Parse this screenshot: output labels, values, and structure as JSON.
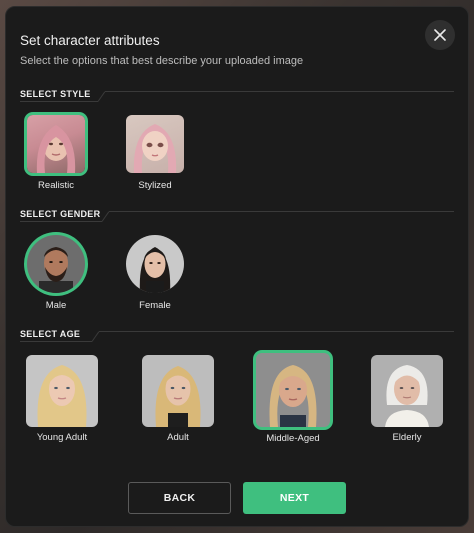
{
  "dialog": {
    "title": "Set character attributes",
    "subtitle": "Select the options that best describe your uploaded image"
  },
  "sections": {
    "style": {
      "label": "SELECT STYLE",
      "options": [
        {
          "label": "Realistic",
          "selected": true
        },
        {
          "label": "Stylized",
          "selected": false
        }
      ]
    },
    "gender": {
      "label": "SELECT GENDER",
      "options": [
        {
          "label": "Male",
          "selected": true
        },
        {
          "label": "Female",
          "selected": false
        }
      ]
    },
    "age": {
      "label": "SELECT AGE",
      "options": [
        {
          "label": "Young Adult",
          "selected": false
        },
        {
          "label": "Adult",
          "selected": false
        },
        {
          "label": "Middle-Aged",
          "selected": true
        },
        {
          "label": "Elderly",
          "selected": false
        }
      ]
    }
  },
  "buttons": {
    "back": "BACK",
    "next": "NEXT"
  },
  "colors": {
    "accent": "#3fbf7f",
    "panel": "#1b1b1b",
    "rule": "#3a3a3a"
  },
  "icons": {
    "close": "close-icon"
  }
}
